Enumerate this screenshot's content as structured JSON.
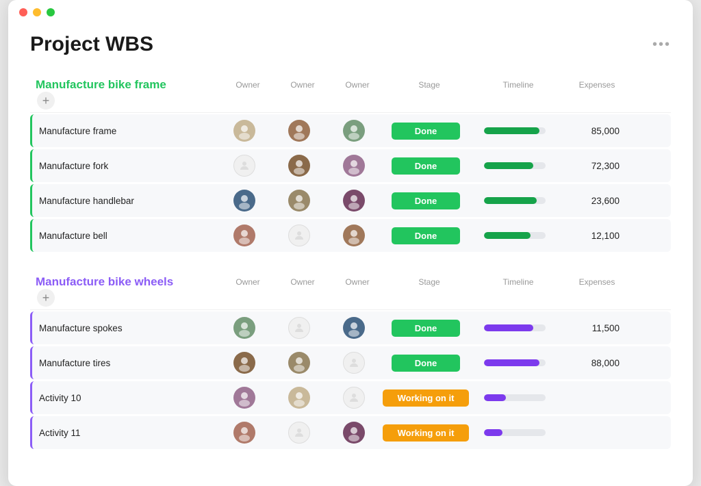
{
  "window": {
    "title": "Project WBS"
  },
  "page": {
    "title": "Project WBS",
    "more_label": "•••"
  },
  "sections": [
    {
      "id": "section-frame",
      "title": "Manufacture bike frame",
      "color": "green",
      "columns": [
        "Owner",
        "Owner",
        "Owner",
        "Stage",
        "Timeline",
        "Expenses"
      ],
      "rows": [
        {
          "name": "Manufacture frame",
          "avatars": [
            "av1",
            "av2",
            "av3"
          ],
          "stage": "Done",
          "stage_type": "done",
          "timeline_pct": 90,
          "timeline_color": "green",
          "expenses": "85,000"
        },
        {
          "name": "Manufacture fork",
          "avatars": [
            "placeholder",
            "av5",
            "av6"
          ],
          "stage": "Done",
          "stage_type": "done",
          "timeline_pct": 80,
          "timeline_color": "green",
          "expenses": "72,300"
        },
        {
          "name": "Manufacture handlebar",
          "avatars": [
            "av7",
            "av8",
            "av9"
          ],
          "stage": "Done",
          "stage_type": "done",
          "timeline_pct": 85,
          "timeline_color": "green",
          "expenses": "23,600"
        },
        {
          "name": "Manufacture bell",
          "avatars": [
            "av4",
            "placeholder",
            "av2"
          ],
          "stage": "Done",
          "stage_type": "done",
          "timeline_pct": 75,
          "timeline_color": "green",
          "expenses": "12,100"
        }
      ]
    },
    {
      "id": "section-wheels",
      "title": "Manufacture bike wheels",
      "color": "purple",
      "columns": [
        "Owner",
        "Owner",
        "Owner",
        "Stage",
        "Timeline",
        "Expenses"
      ],
      "rows": [
        {
          "name": "Manufacture spokes",
          "avatars": [
            "av3",
            "placeholder",
            "av7"
          ],
          "stage": "Done",
          "stage_type": "done",
          "timeline_pct": 80,
          "timeline_color": "purple",
          "expenses": "11,500"
        },
        {
          "name": "Manufacture tires",
          "avatars": [
            "av5",
            "av8",
            "placeholder"
          ],
          "stage": "Done",
          "stage_type": "done",
          "timeline_pct": 90,
          "timeline_color": "purple",
          "expenses": "88,000"
        },
        {
          "name": "Activity 10",
          "avatars": [
            "av6",
            "av1",
            "placeholder"
          ],
          "stage": "Working on it",
          "stage_type": "working",
          "timeline_pct": 35,
          "timeline_color": "purple",
          "expenses": ""
        },
        {
          "name": "Activity 11",
          "avatars": [
            "av4",
            "placeholder",
            "av9"
          ],
          "stage": "Working on it",
          "stage_type": "working",
          "timeline_pct": 30,
          "timeline_color": "purple",
          "expenses": ""
        }
      ]
    }
  ]
}
